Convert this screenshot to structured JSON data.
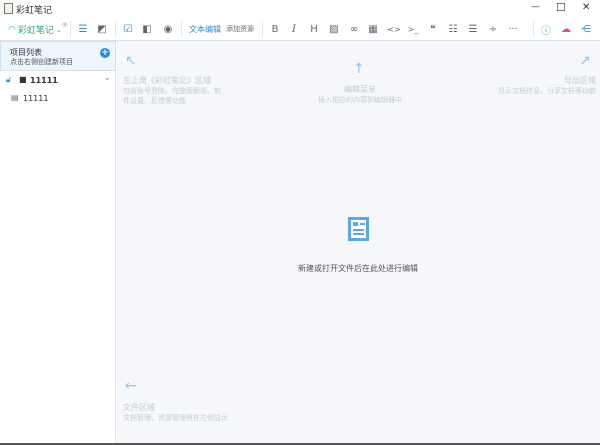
{
  "window": {
    "title": "彩虹笔记",
    "minimize": "—",
    "maximize": "☐",
    "close": "✕"
  },
  "toolbar": {
    "brand": "彩虹笔记",
    "text_edit": "文本编辑",
    "add_resource": "添加资源",
    "bold": "B",
    "italic": "I",
    "heading": "H",
    "code": "<>",
    "terminal": ">_",
    "quote": "❝",
    "divide": "÷",
    "more": "···"
  },
  "sidebar": {
    "header_title": "项目列表",
    "header_subtitle": "点击右侧创建新项目",
    "add": "+",
    "items": [
      {
        "label": "11111"
      },
      {
        "label": "11111"
      }
    ]
  },
  "main": {
    "top_left": {
      "title": "左上角《彩虹笔记》区域",
      "desc1": "包含账号登陆、完整版解锁、软",
      "desc2": "件设置、反馈等功能"
    },
    "top_center": {
      "title": "编辑菜单",
      "desc": "插入相应的内容到编辑器中"
    },
    "top_right": {
      "title": "导出区域",
      "desc": "显示文档信息，分享文档等功能"
    },
    "bottom_left": {
      "title": "文件区域",
      "desc": "文档管理、资源管理将在左侧显示"
    },
    "center_text": "新建或打开文件后在此处进行编辑"
  },
  "colors": {
    "accent": "#2a8bd8",
    "brand": "#3aa18f",
    "info": "#35b86b",
    "cloud": "#e8478b"
  }
}
